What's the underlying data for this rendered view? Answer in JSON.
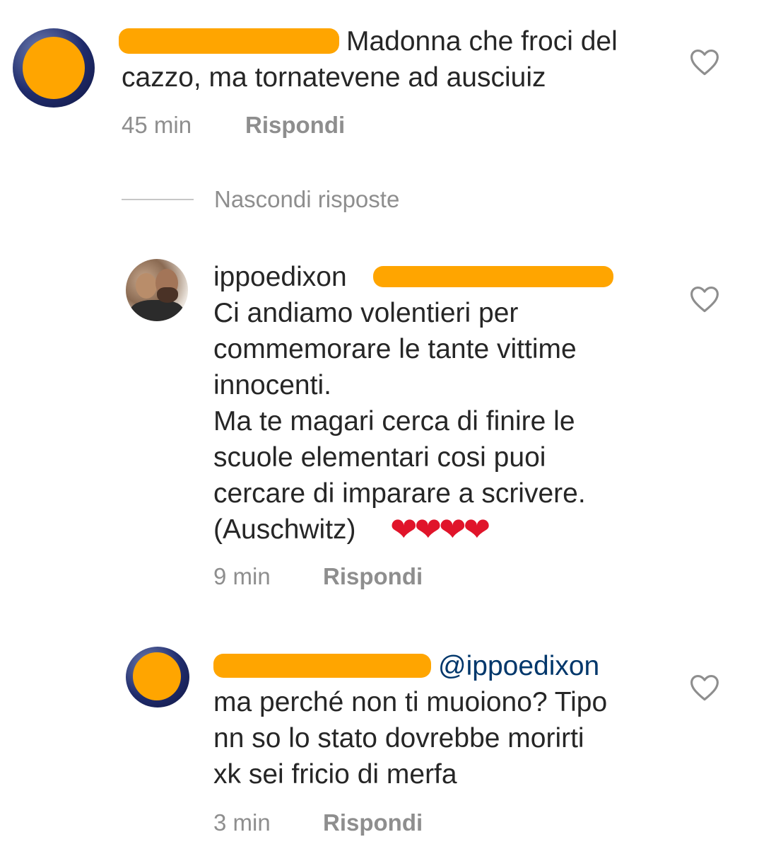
{
  "comments": [
    {
      "text": "Madonna che froci del\ncazzo, ma tornatevene ad ausciuiz",
      "time": "45 min",
      "reply_label": "Rispondi"
    },
    {
      "username": "ippoedixon",
      "text": "Ci andiamo volentieri per\ncommemorare le tante vittime\ninnocenti.\nMa te magari cerca di finire le\nscuole elementari cosi puoi\ncercare di imparare a scrivere.\n(Auschwitz)",
      "emoji": "❤❤❤❤",
      "time": "9 min",
      "reply_label": "Rispondi"
    },
    {
      "mention": "@ippoedixon",
      "text": "ma perché non ti muoiono? Tipo\nnn so lo stato dovrebbe morirti\nxk sei fricio di merfa",
      "time": "3 min",
      "reply_label": "Rispondi"
    }
  ],
  "replies_toggle": "Nascondi risposte",
  "colors": {
    "text": "#262626",
    "meta": "#8e8e8e",
    "mention": "#00376b",
    "redaction": "#ffa500",
    "heart_emoji": "#e0142a"
  },
  "icons": [
    "heart-outline-icon"
  ]
}
